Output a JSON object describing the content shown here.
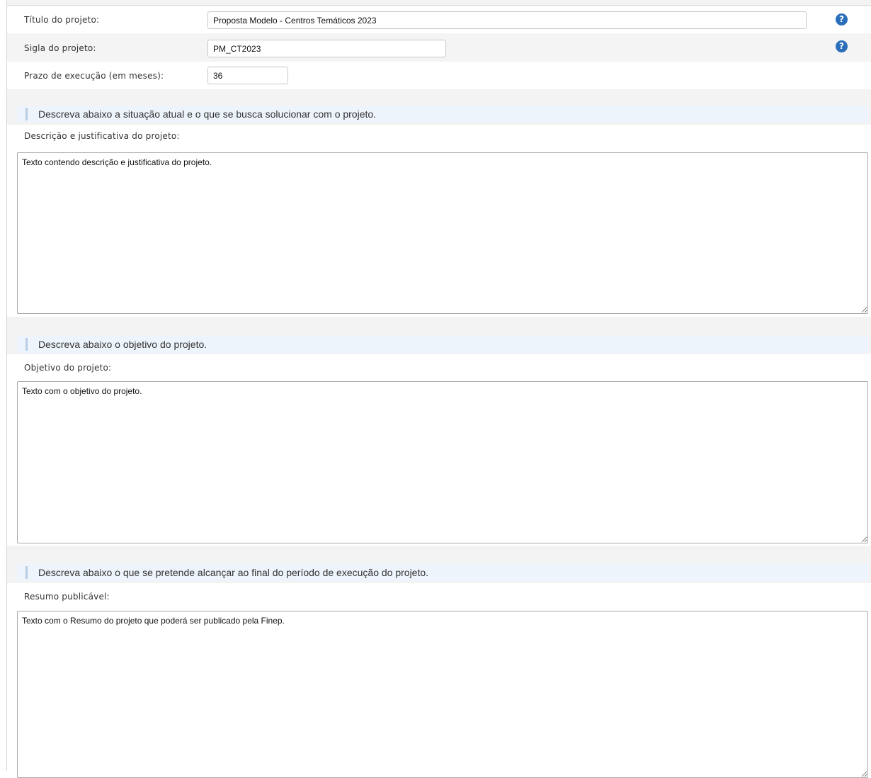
{
  "fields": {
    "titulo": {
      "label": "Título do projeto:",
      "value": "Proposta Modelo - Centros Temáticos 2023",
      "help": "?"
    },
    "sigla": {
      "label": "Sigla do projeto:",
      "value": "PM_CT2023",
      "help": "?"
    },
    "prazo": {
      "label": "Prazo de execução (em meses):",
      "value": "36"
    }
  },
  "sections": [
    {
      "heading": "Descreva abaixo a situação atual e o que se busca solucionar com o projeto.",
      "label": "Descrição e justificativa do projeto:",
      "value": "Texto contendo descrição e justificativa do projeto."
    },
    {
      "heading": "Descreva abaixo o objetivo do projeto.",
      "label": "Objetivo do projeto:",
      "value": "Texto com o objetivo do projeto."
    },
    {
      "heading": "Descreva abaixo o que se pretende alcançar ao final do período de execução do projeto.",
      "label": "Resumo publicável:",
      "value": "Texto com o Resumo do projeto que poderá ser publicado pela Finep."
    }
  ],
  "colors": {
    "help_icon": "#2a6ebb",
    "section_bg": "#eef4fb",
    "section_bar": "#b9cde3"
  }
}
